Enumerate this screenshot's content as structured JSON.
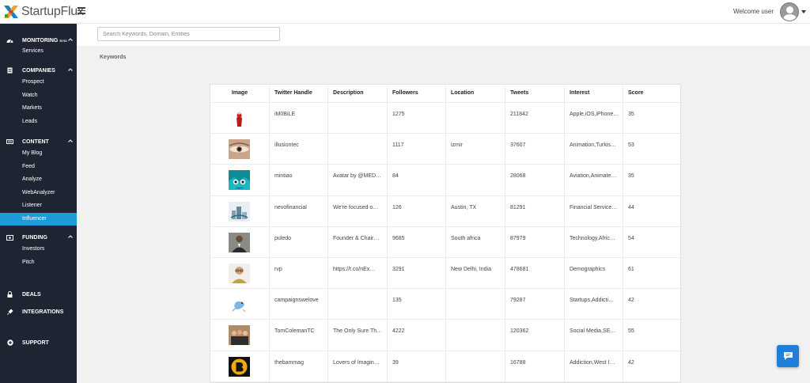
{
  "app": {
    "name": "StartupFlux"
  },
  "header": {
    "welcome_text": "Welcome user"
  },
  "search": {
    "placeholder": "Search Keywords, Domain, Entities"
  },
  "page": {
    "section_label": "Keywords"
  },
  "sidebar": {
    "sections": [
      {
        "title": "MONITORING",
        "badge": "Beta",
        "icon": "dashboard-icon",
        "items": [
          "Services"
        ]
      },
      {
        "title": "COMPANIES",
        "icon": "document-icon",
        "items": [
          "Prospect",
          "Watch",
          "Markets",
          "Leads"
        ]
      },
      {
        "title": "CONTENT",
        "icon": "monitor-icon",
        "items": [
          "My Blog",
          "Feed",
          "Analyze",
          "WebAnalyzer",
          "Listener",
          "Influencer"
        ],
        "active": "Influencer"
      },
      {
        "title": "FUNDING",
        "icon": "money-icon",
        "items": [
          "Investors",
          "Pitch"
        ]
      },
      {
        "title": "DEALS",
        "icon": "lock-icon",
        "items": []
      },
      {
        "title": "INTEGRATIONS",
        "icon": "plug-icon",
        "items": []
      },
      {
        "title": "SUPPORT",
        "icon": "plus-circle-icon",
        "items": []
      }
    ]
  },
  "table": {
    "columns": [
      "Image",
      "Twitter Handle",
      "Description",
      "Followers",
      "Location",
      "Tweets",
      "Interest",
      "Score"
    ],
    "rows": [
      {
        "handle": "iM0BiLE",
        "description": "",
        "followers": "1275",
        "location": "",
        "tweets": "211842",
        "interest": "Apple,iOS,iPhone…",
        "score": "35",
        "thumb": "red-figure"
      },
      {
        "handle": "illusiontec",
        "description": "",
        "followers": "1117",
        "location": "izmir",
        "tweets": "37607",
        "interest": "Animation,Turkis…",
        "score": "53",
        "thumb": "eye"
      },
      {
        "handle": "mintiao",
        "description": "Avatar by @MED…",
        "followers": "84",
        "location": "",
        "tweets": "28068",
        "interest": "Aviation,Animate…",
        "score": "35",
        "thumb": "anime"
      },
      {
        "handle": "nevofinancial",
        "description": "We're focused o…",
        "followers": "126",
        "location": "Austin, TX",
        "tweets": "81291",
        "interest": "Financial Service…",
        "score": "44",
        "thumb": "city"
      },
      {
        "handle": "puledo",
        "description": "Founder & Chair…",
        "followers": "9685",
        "location": "South africa",
        "tweets": "87979",
        "interest": "Technology,Afric…",
        "score": "54",
        "thumb": "man-suit"
      },
      {
        "handle": "rvp",
        "description": "https://t.co/nEx…",
        "followers": "3291",
        "location": "New Delhi, India",
        "tweets": "478681",
        "interest": "Demographics",
        "score": "61",
        "thumb": "man-glasses"
      },
      {
        "handle": "campaignswelove",
        "description": "",
        "followers": "135",
        "location": "",
        "tweets": "79287",
        "interest": "Startups,Addicti…",
        "score": "42",
        "thumb": "bird"
      },
      {
        "handle": "TomColemanTC",
        "description": "The Only Sure Th…",
        "followers": "4222",
        "location": "",
        "tweets": "120362",
        "interest": "Social Media,SE…",
        "score": "55",
        "thumb": "group"
      },
      {
        "handle": "thebammag",
        "description": "Lovers of Imagin…",
        "followers": "39",
        "location": "",
        "tweets": "16788",
        "interest": "Addiction,West I…",
        "score": "42",
        "thumb": "logo-b"
      }
    ]
  },
  "colors": {
    "sidebar_bg": "#1f2433",
    "active": "#1b9bd7",
    "chat_button": "#1f7fd8"
  }
}
